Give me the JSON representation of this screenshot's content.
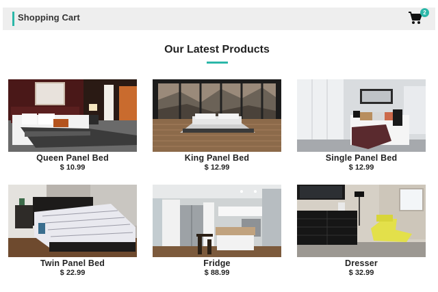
{
  "header": {
    "title": "Shopping Cart",
    "cart_count": "2",
    "accent_color": "#2bb7a8",
    "cart_icon": "shopping-cart-icon"
  },
  "section": {
    "title": "Our Latest Products"
  },
  "products": [
    {
      "name": "Queen Panel Bed",
      "price": "$ 10.99"
    },
    {
      "name": "King Panel Bed",
      "price": "$ 12.99"
    },
    {
      "name": "Single Panel Bed",
      "price": "$ 12.99"
    },
    {
      "name": "Twin Panel Bed",
      "price": "$ 22.99"
    },
    {
      "name": "Fridge",
      "price": "$ 88.99"
    },
    {
      "name": "Dresser",
      "price": "$ 32.99"
    }
  ]
}
